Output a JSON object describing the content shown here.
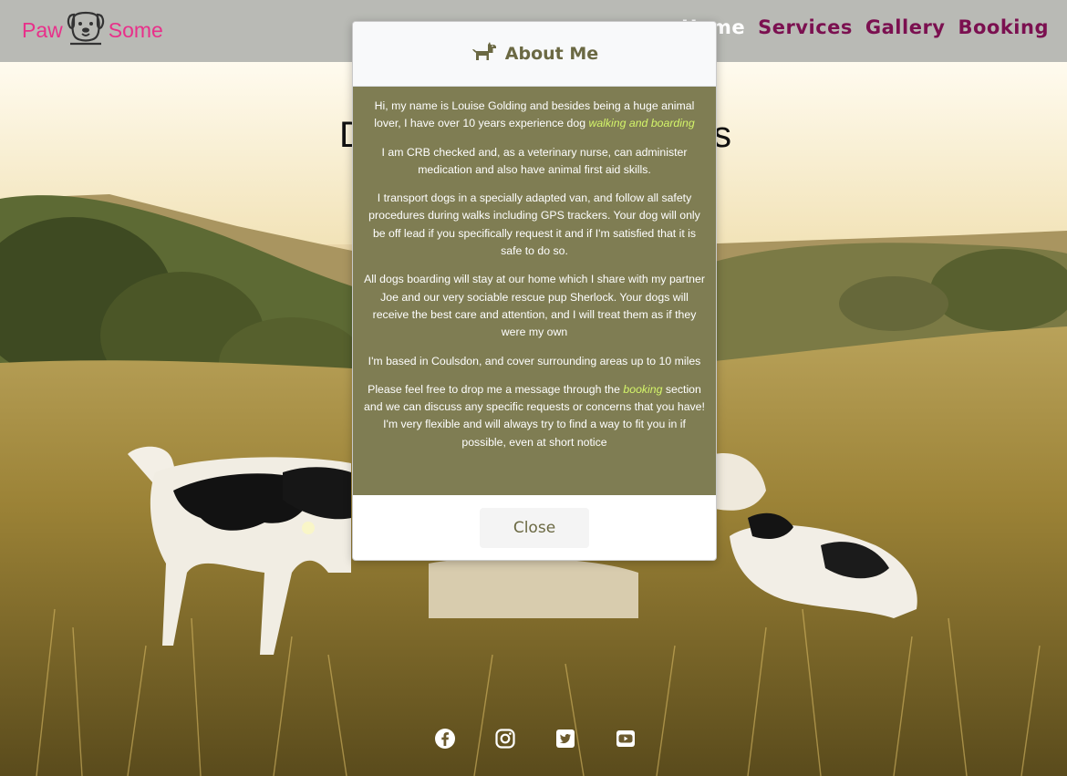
{
  "brand": {
    "left": "Paw",
    "right": "Some",
    "color": "#e8308a",
    "logo_icon": "dog-face-icon"
  },
  "nav": {
    "items": [
      {
        "label": "Home",
        "active": true
      },
      {
        "label": "Services",
        "active": false
      },
      {
        "label": "Gallery",
        "active": false
      },
      {
        "label": "Booking",
        "active": false
      }
    ]
  },
  "hero": {
    "left": "D",
    "right": "s"
  },
  "modal": {
    "icon": "dog-icon",
    "title": "About Me",
    "paragraphs": [
      {
        "before": "Hi, my name is Louise Golding and besides being a huge animal lover, I have over 10 years experience dog ",
        "highlight": "walking and boarding",
        "after": ""
      },
      {
        "before": "I am CRB checked and, as a veterinary nurse, can administer medication and also have animal first aid skills.",
        "highlight": "",
        "after": ""
      },
      {
        "before": "I transport dogs in a specially adapted van, and follow all safety procedures during walks including GPS trackers. Your dog will only be off lead if you specifically request it and if I'm satisfied that it is safe to do so.",
        "highlight": "",
        "after": ""
      },
      {
        "before": "All dogs boarding will stay at our home which I share with my partner Joe and our very sociable rescue pup Sherlock. Your dogs will receive the best care and attention, and I will treat them as if they were my own",
        "highlight": "",
        "after": ""
      },
      {
        "before": "I'm based in Coulsdon, and cover surrounding areas up to 10 miles",
        "highlight": "",
        "after": ""
      },
      {
        "before": "Please feel free to drop me a message through the ",
        "highlight": "booking",
        "after": " section and we can discuss any specific requests or concerns that you have! I'm very flexible and will always try to find a way to fit you in if possible, even at short notice"
      }
    ],
    "close_label": "Close"
  },
  "socials": [
    "facebook-icon",
    "instagram-icon",
    "twitter-icon",
    "youtube-icon"
  ],
  "colors": {
    "navbar": "#b9bab5",
    "nav_link": "#7b1050",
    "modal_body": "#7f7d53",
    "highlight": "#d4f56a",
    "modal_title": "#6b6943"
  }
}
